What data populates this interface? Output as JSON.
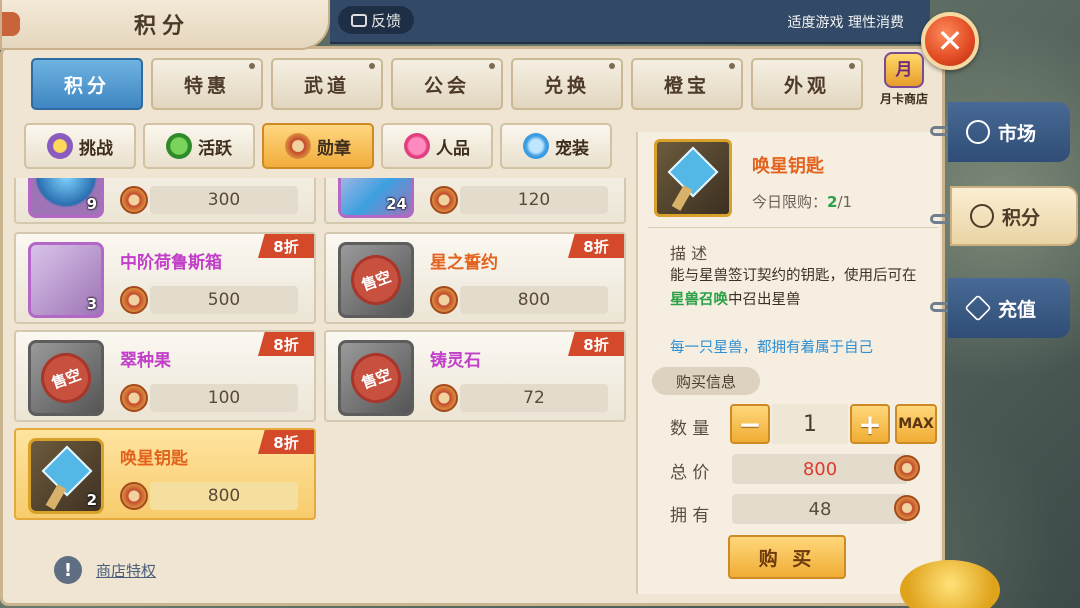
{
  "window": {
    "title": "积分",
    "feedback_label": "反馈",
    "moderate_notice": "适度游戏 理性消费",
    "close_label": "✕"
  },
  "main_tabs": [
    {
      "label": "积分",
      "active": true
    },
    {
      "label": "特惠"
    },
    {
      "label": "武道"
    },
    {
      "label": "公会"
    },
    {
      "label": "兑换"
    },
    {
      "label": "橙宝"
    },
    {
      "label": "外观"
    }
  ],
  "month_card": {
    "icon_text": "月",
    "label": "月卡商店"
  },
  "sub_tabs": [
    {
      "label": "挑战",
      "icon": "star-medal-icon"
    },
    {
      "label": "活跃",
      "icon": "active-badge-icon"
    },
    {
      "label": "勋章",
      "icon": "medal-icon",
      "active": true
    },
    {
      "label": "人品",
      "icon": "heart-icon"
    },
    {
      "label": "宠装",
      "icon": "pet-gear-icon"
    }
  ],
  "items": [
    {
      "name": "",
      "qty": "9",
      "price": "300"
    },
    {
      "name": "",
      "qty": "24",
      "price": "120"
    },
    {
      "name": "中阶荷鲁斯箱",
      "qty": "3",
      "price": "500",
      "discount": "8折"
    },
    {
      "name": "星之誓约",
      "qty": "",
      "price": "800",
      "discount": "8折",
      "sold_out": "售空"
    },
    {
      "name": "翠种果",
      "qty": "",
      "price": "100",
      "discount": "8折",
      "sold_out": "售空"
    },
    {
      "name": "铸灵石",
      "qty": "",
      "price": "72",
      "discount": "8折",
      "sold_out": "售空"
    },
    {
      "name": "唤星钥匙",
      "qty": "2",
      "price": "800",
      "discount": "8折",
      "selected": true
    }
  ],
  "privilege": {
    "icon": "!",
    "label": "商店特权"
  },
  "detail": {
    "name": "唤星钥匙",
    "limit_label": "今日限购：",
    "limit_value": "2",
    "limit_total": "/1",
    "desc_header": "描 述",
    "desc_part1": "能与星兽签订契约的钥匙，使用后可在",
    "desc_link": "星兽召唤",
    "desc_part2": "中召出星兽",
    "flavor": "每一只星兽，都拥有着属于自己",
    "buy_info": "购买信息",
    "qty_label": "数 量",
    "qty_value": "1",
    "minus": "−",
    "plus": "+",
    "max": "MAX",
    "total_label": "总 价",
    "total_value": "800",
    "own_label": "拥 有",
    "own_value": "48",
    "buy_label": "购 买"
  },
  "side_nav": [
    {
      "label": "市场",
      "icon": "scale-icon"
    },
    {
      "label": "积分",
      "icon": "points-icon",
      "active": true
    },
    {
      "label": "充值",
      "icon": "diamond-icon"
    }
  ],
  "colors": {
    "active_tab": "#3f86c2",
    "discount": "#d5492b",
    "name_purple": "#c23fc9",
    "name_orange": "#e3631e",
    "limit_green": "#2aa147",
    "flavor_blue": "#2f8fd3",
    "total_red": "#de3b2e"
  }
}
